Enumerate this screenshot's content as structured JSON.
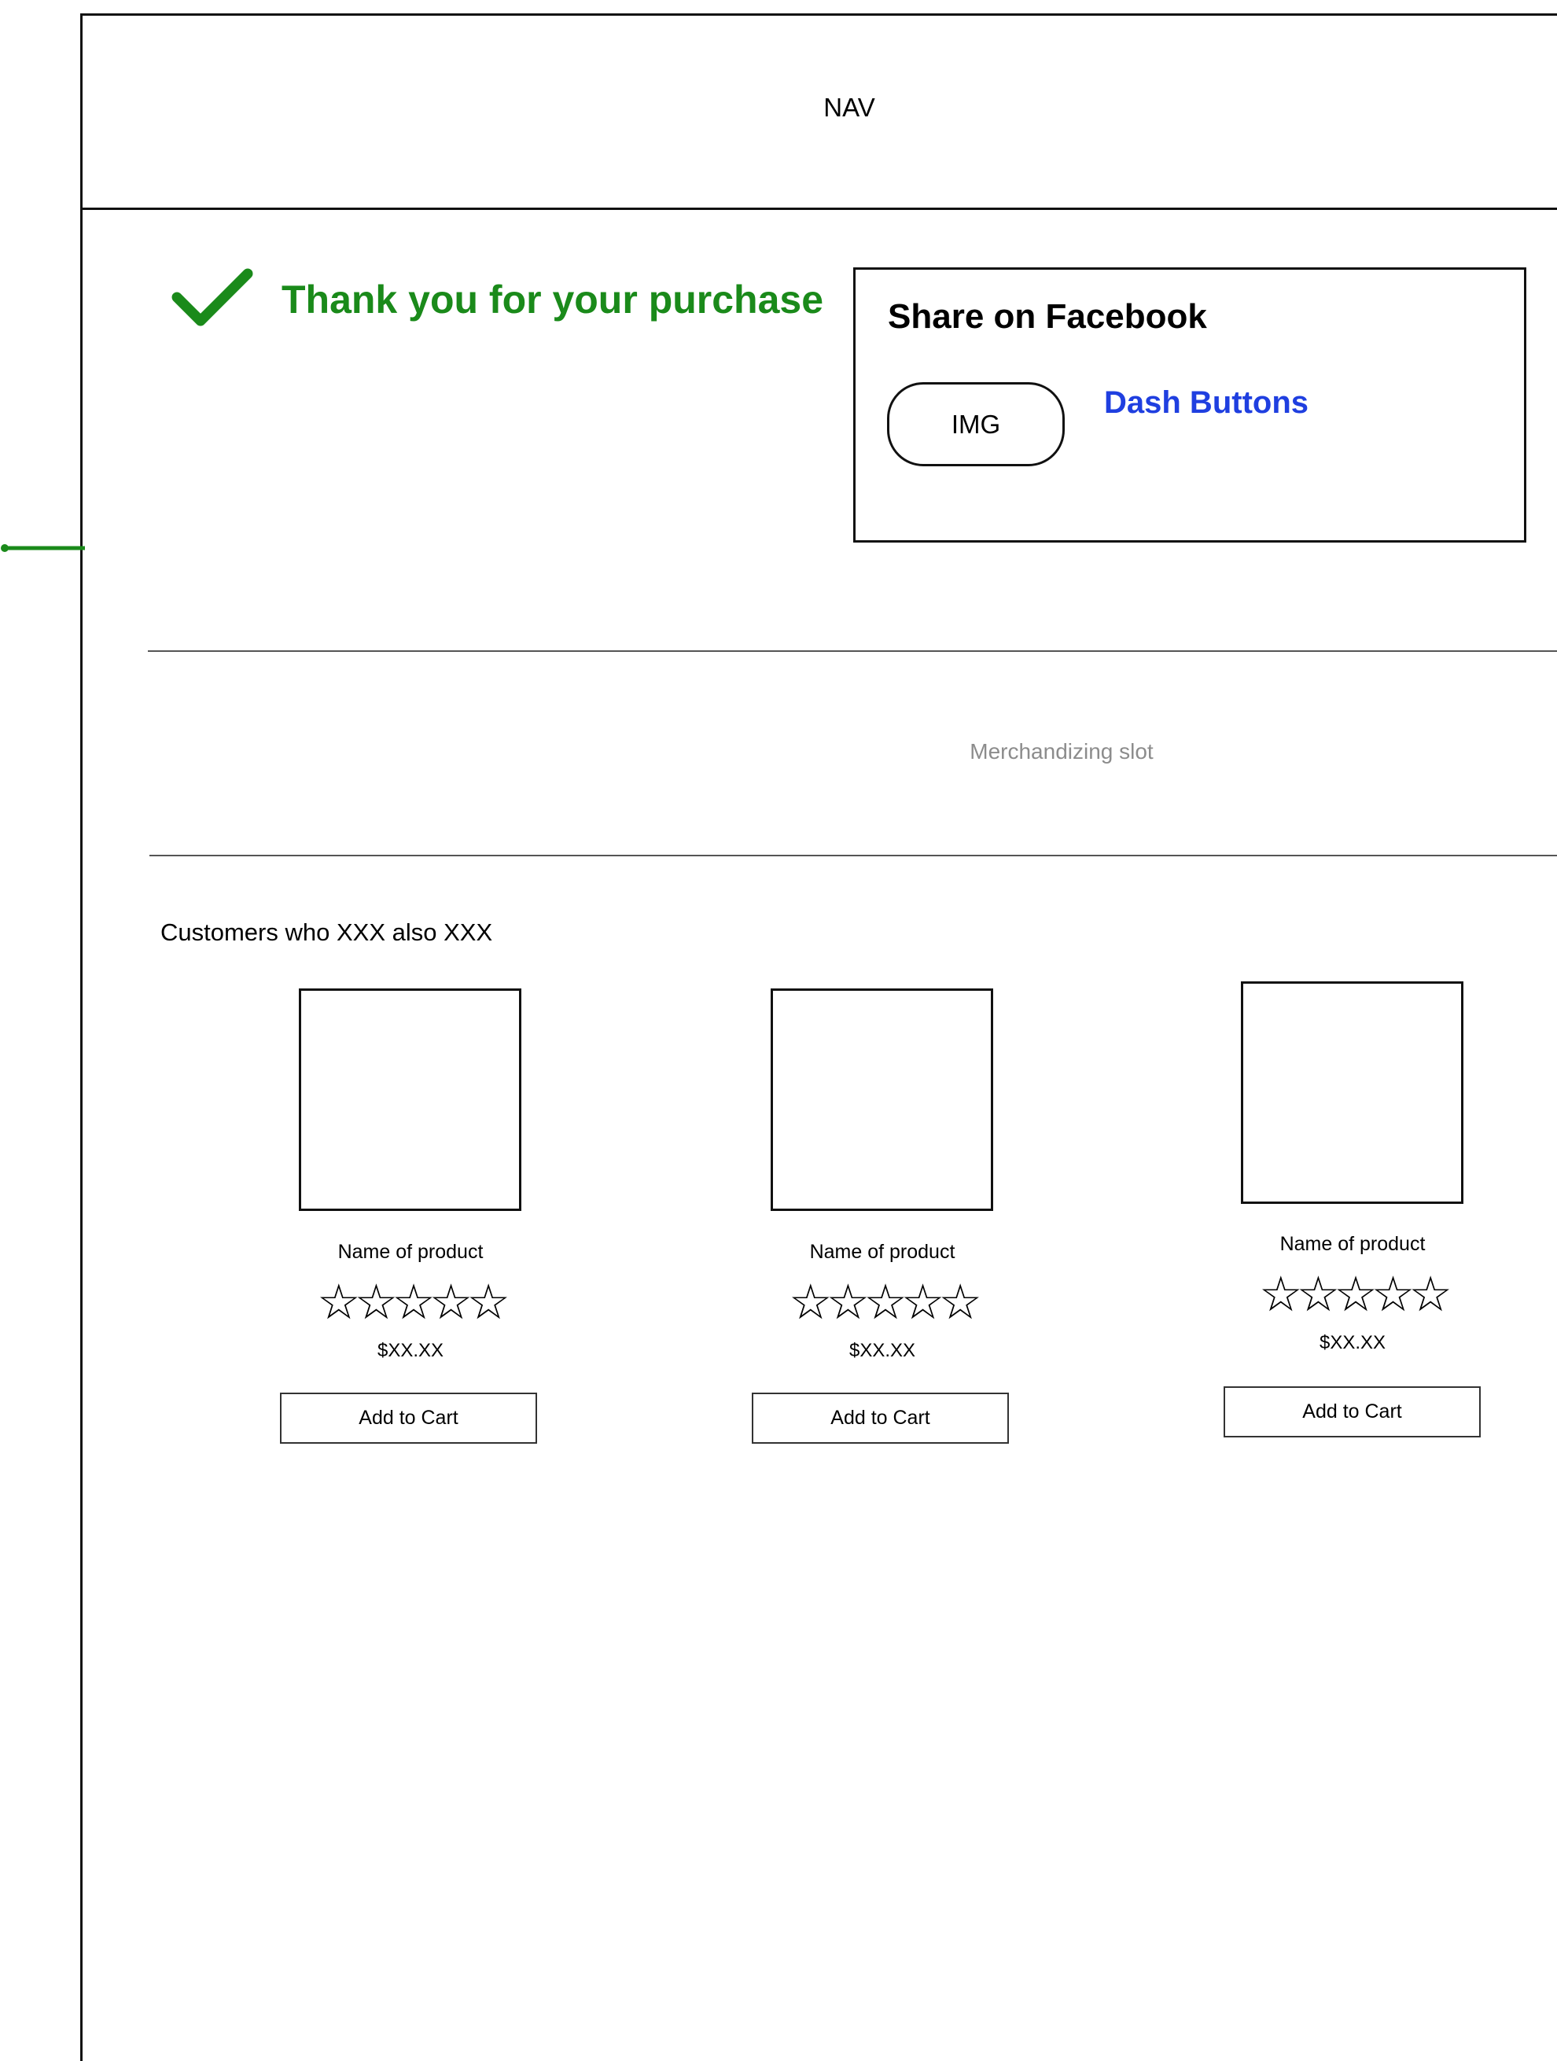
{
  "nav": {
    "label": "NAV"
  },
  "confirmation": {
    "message": "Thank you for your purchase",
    "accent_color": "#1a8a1a",
    "icon": "checkmark-icon"
  },
  "share": {
    "title": "Share on Facebook",
    "img_label": "IMG",
    "dash_buttons_label": "Dash Buttons",
    "dash_buttons_color": "#1f3fe0"
  },
  "merchandizing": {
    "label": "Merchandizing slot"
  },
  "recommendations": {
    "title": "Customers who XXX also XXX",
    "products": [
      {
        "name": "Name of product",
        "stars": "☆☆☆☆☆",
        "rating": 0,
        "price": "$XX.XX",
        "cta": "Add to Cart"
      },
      {
        "name": "Name of product",
        "stars": "☆☆☆☆☆",
        "rating": 0,
        "price": "$XX.XX",
        "cta": "Add to Cart"
      },
      {
        "name": "Name of product",
        "stars": "☆☆☆☆☆",
        "rating": 0,
        "price": "$XX.XX",
        "cta": "Add to Cart"
      }
    ]
  }
}
